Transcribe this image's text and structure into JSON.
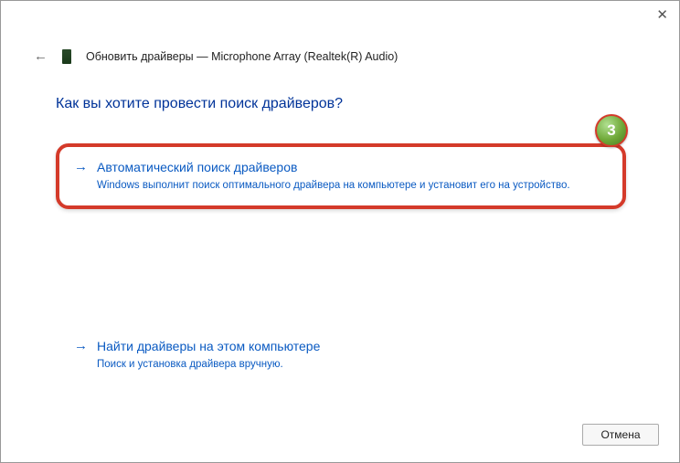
{
  "window": {
    "close": "✕"
  },
  "header": {
    "title": "Обновить драйверы — Microphone Array (Realtek(R) Audio)"
  },
  "heading": "Как вы хотите провести поиск драйверов?",
  "badge": "3",
  "options": {
    "auto": {
      "title": "Автоматический поиск драйверов",
      "desc": "Windows выполнит поиск оптимального драйвера на компьютере и установит его на устройство."
    },
    "manual": {
      "title": "Найти драйверы на этом компьютере",
      "desc": "Поиск и установка драйвера вручную."
    }
  },
  "buttons": {
    "cancel": "Отмена"
  }
}
